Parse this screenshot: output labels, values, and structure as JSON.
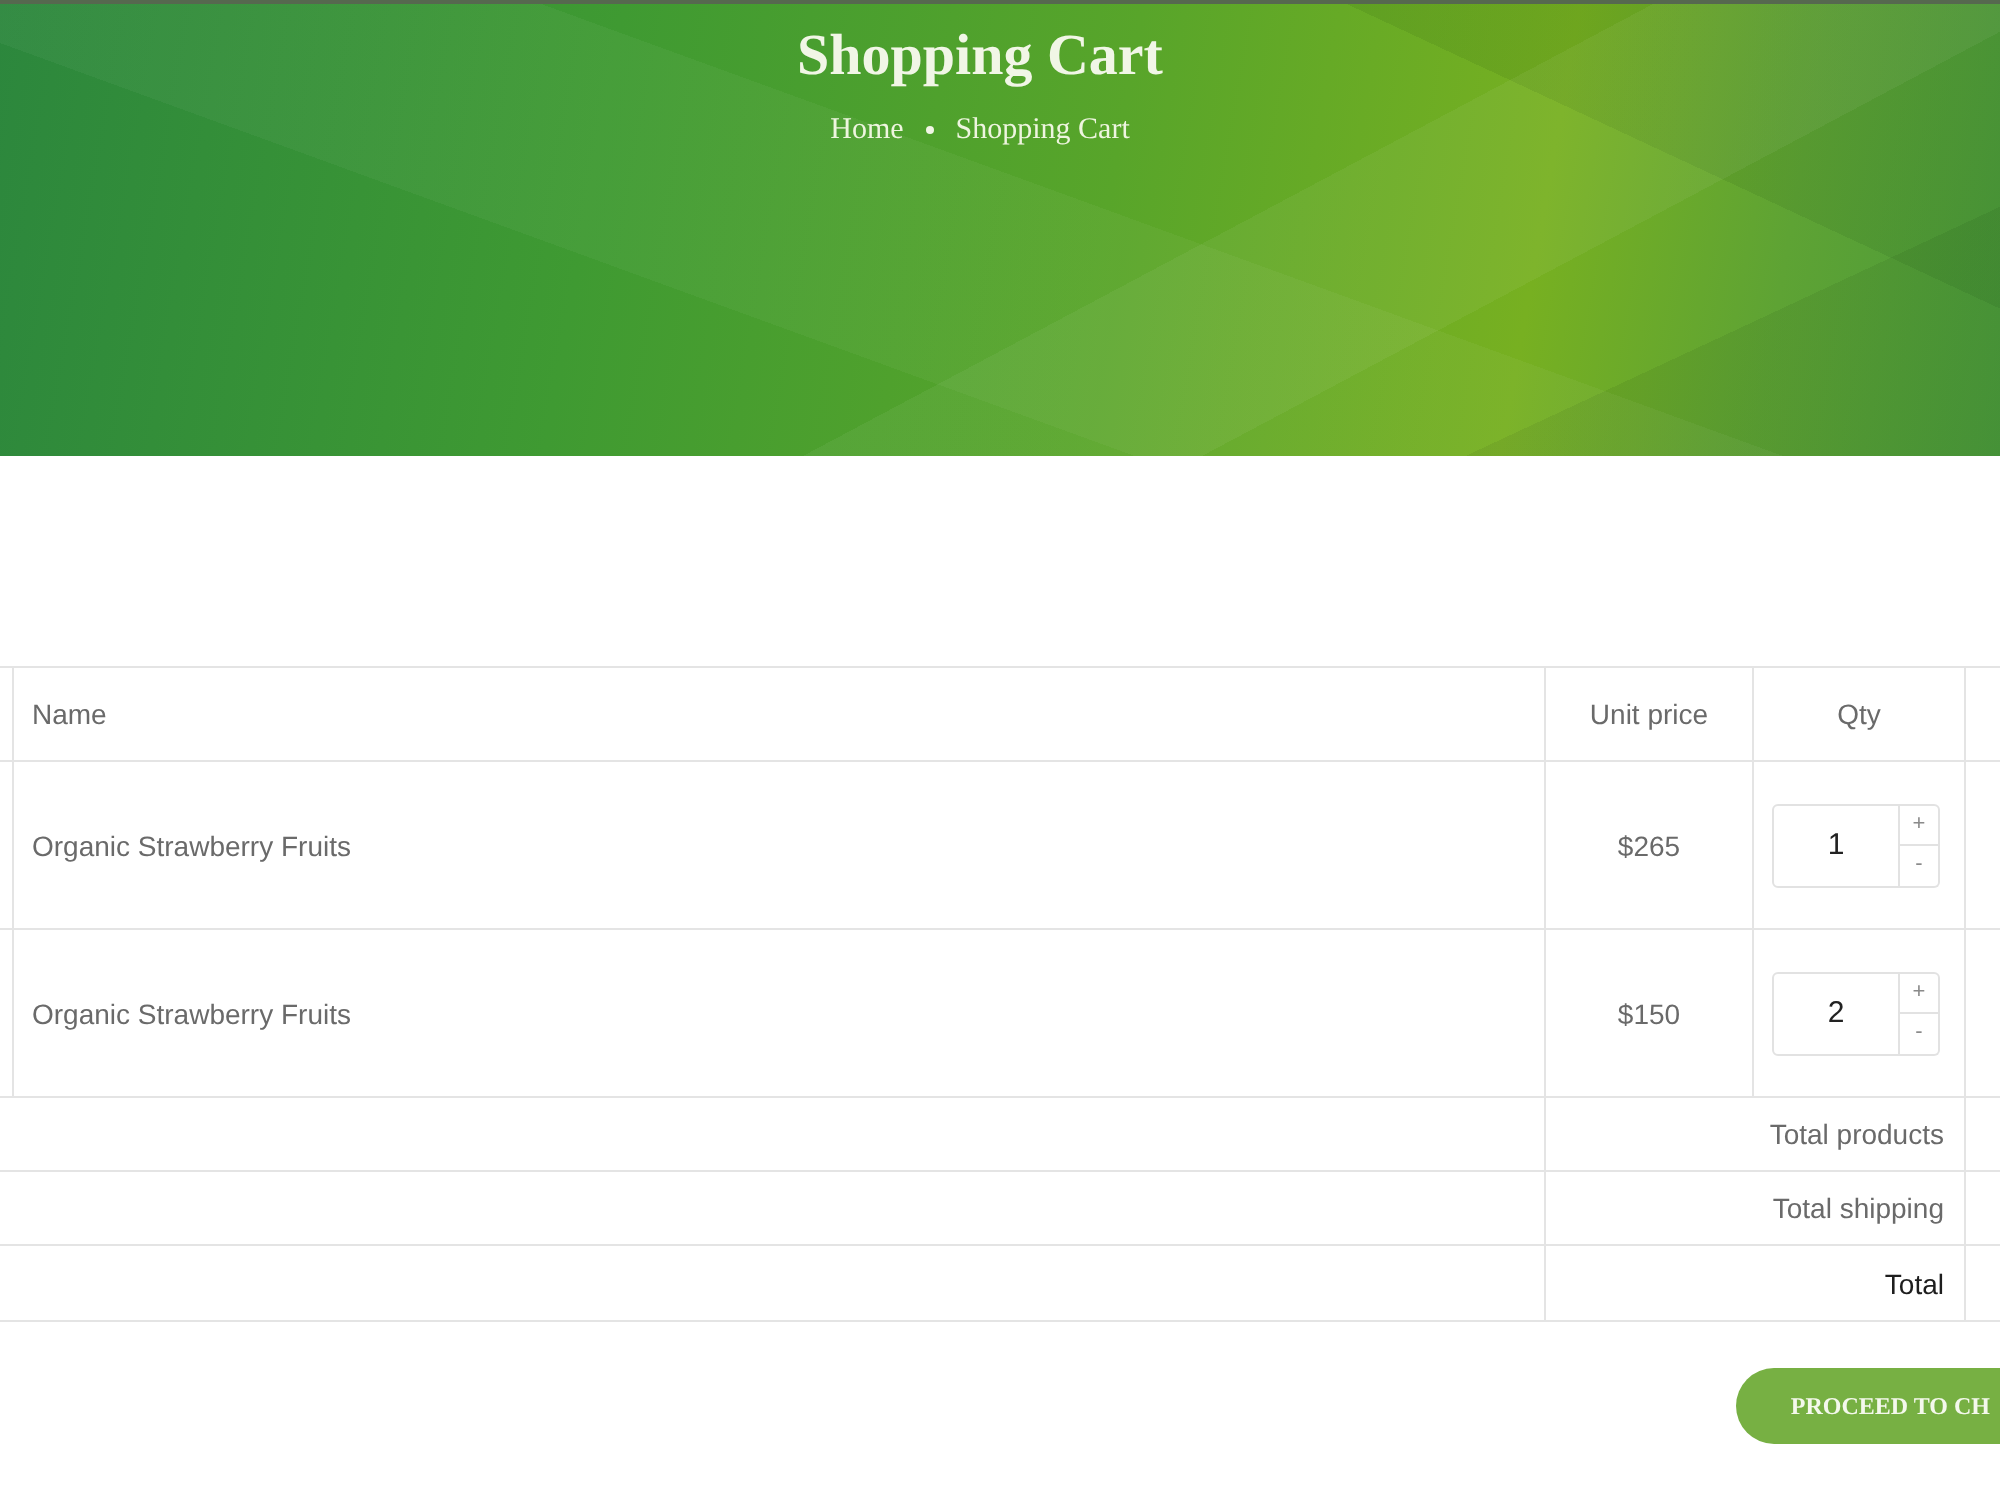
{
  "banner": {
    "title": "Shopping Cart",
    "breadcrumb": [
      "Home",
      "Shopping Cart"
    ]
  },
  "cart_table": {
    "columns": [
      "Name",
      "Unit price",
      "Qty"
    ],
    "rows": [
      {
        "name": "Organic Strawberry Fruits",
        "unit_price": "$265",
        "qty": {
          "value": "1",
          "increase": "+",
          "decrease": "-"
        }
      },
      {
        "name": "Organic Strawberry Fruits",
        "unit_price": "$150",
        "qty": {
          "value": "2",
          "increase": "+",
          "decrease": "-"
        }
      }
    ],
    "totals": [
      {
        "label": "Total products",
        "kind": "subtotal"
      },
      {
        "label": "Total shipping",
        "kind": "subtotal"
      },
      {
        "label": "Total",
        "kind": "grand"
      }
    ]
  },
  "checkout_button": {
    "label": "PROCEED TO CH"
  }
}
